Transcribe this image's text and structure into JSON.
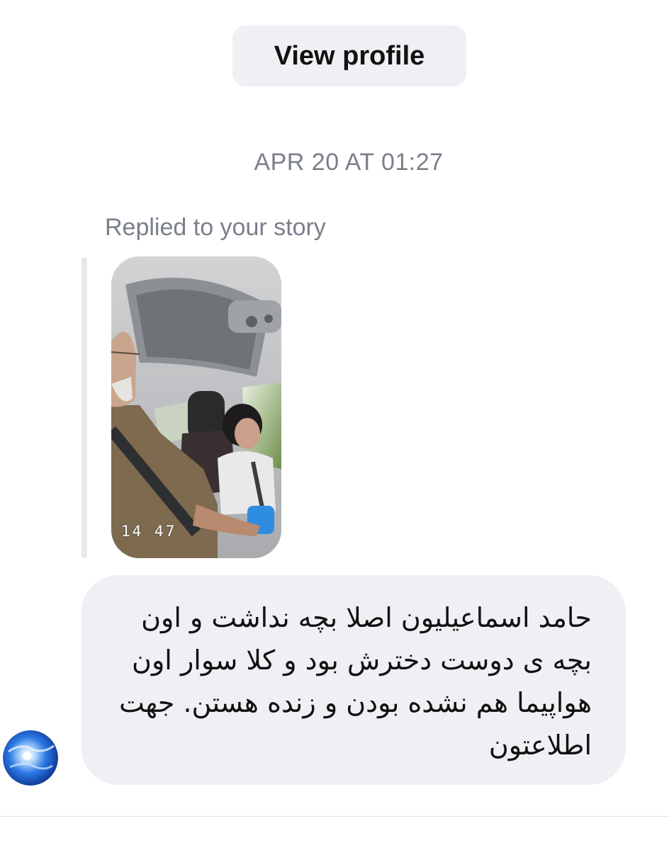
{
  "header": {
    "view_profile_label": "View profile"
  },
  "conversation": {
    "timestamp": "APR 20 AT 01:27",
    "reply_context": "Replied to your story",
    "story": {
      "overlay_time": "14 47"
    },
    "message": {
      "text": "حامد اسماعیلیون اصلا بچه نداشت و اون بچه ی دوست دخترش بود و کلا سوار اون هواپیما هم نشده بودن و زنده هستن. جهت اطلاعتون"
    }
  },
  "colors": {
    "bubble_bg": "#efeff4",
    "button_bg": "#efeff4",
    "meta_text": "#7a7f8a",
    "primary_text": "#111111",
    "avatar_blue": "#1f63d6"
  },
  "icons": {
    "avatar": "globe-avatar-icon"
  }
}
